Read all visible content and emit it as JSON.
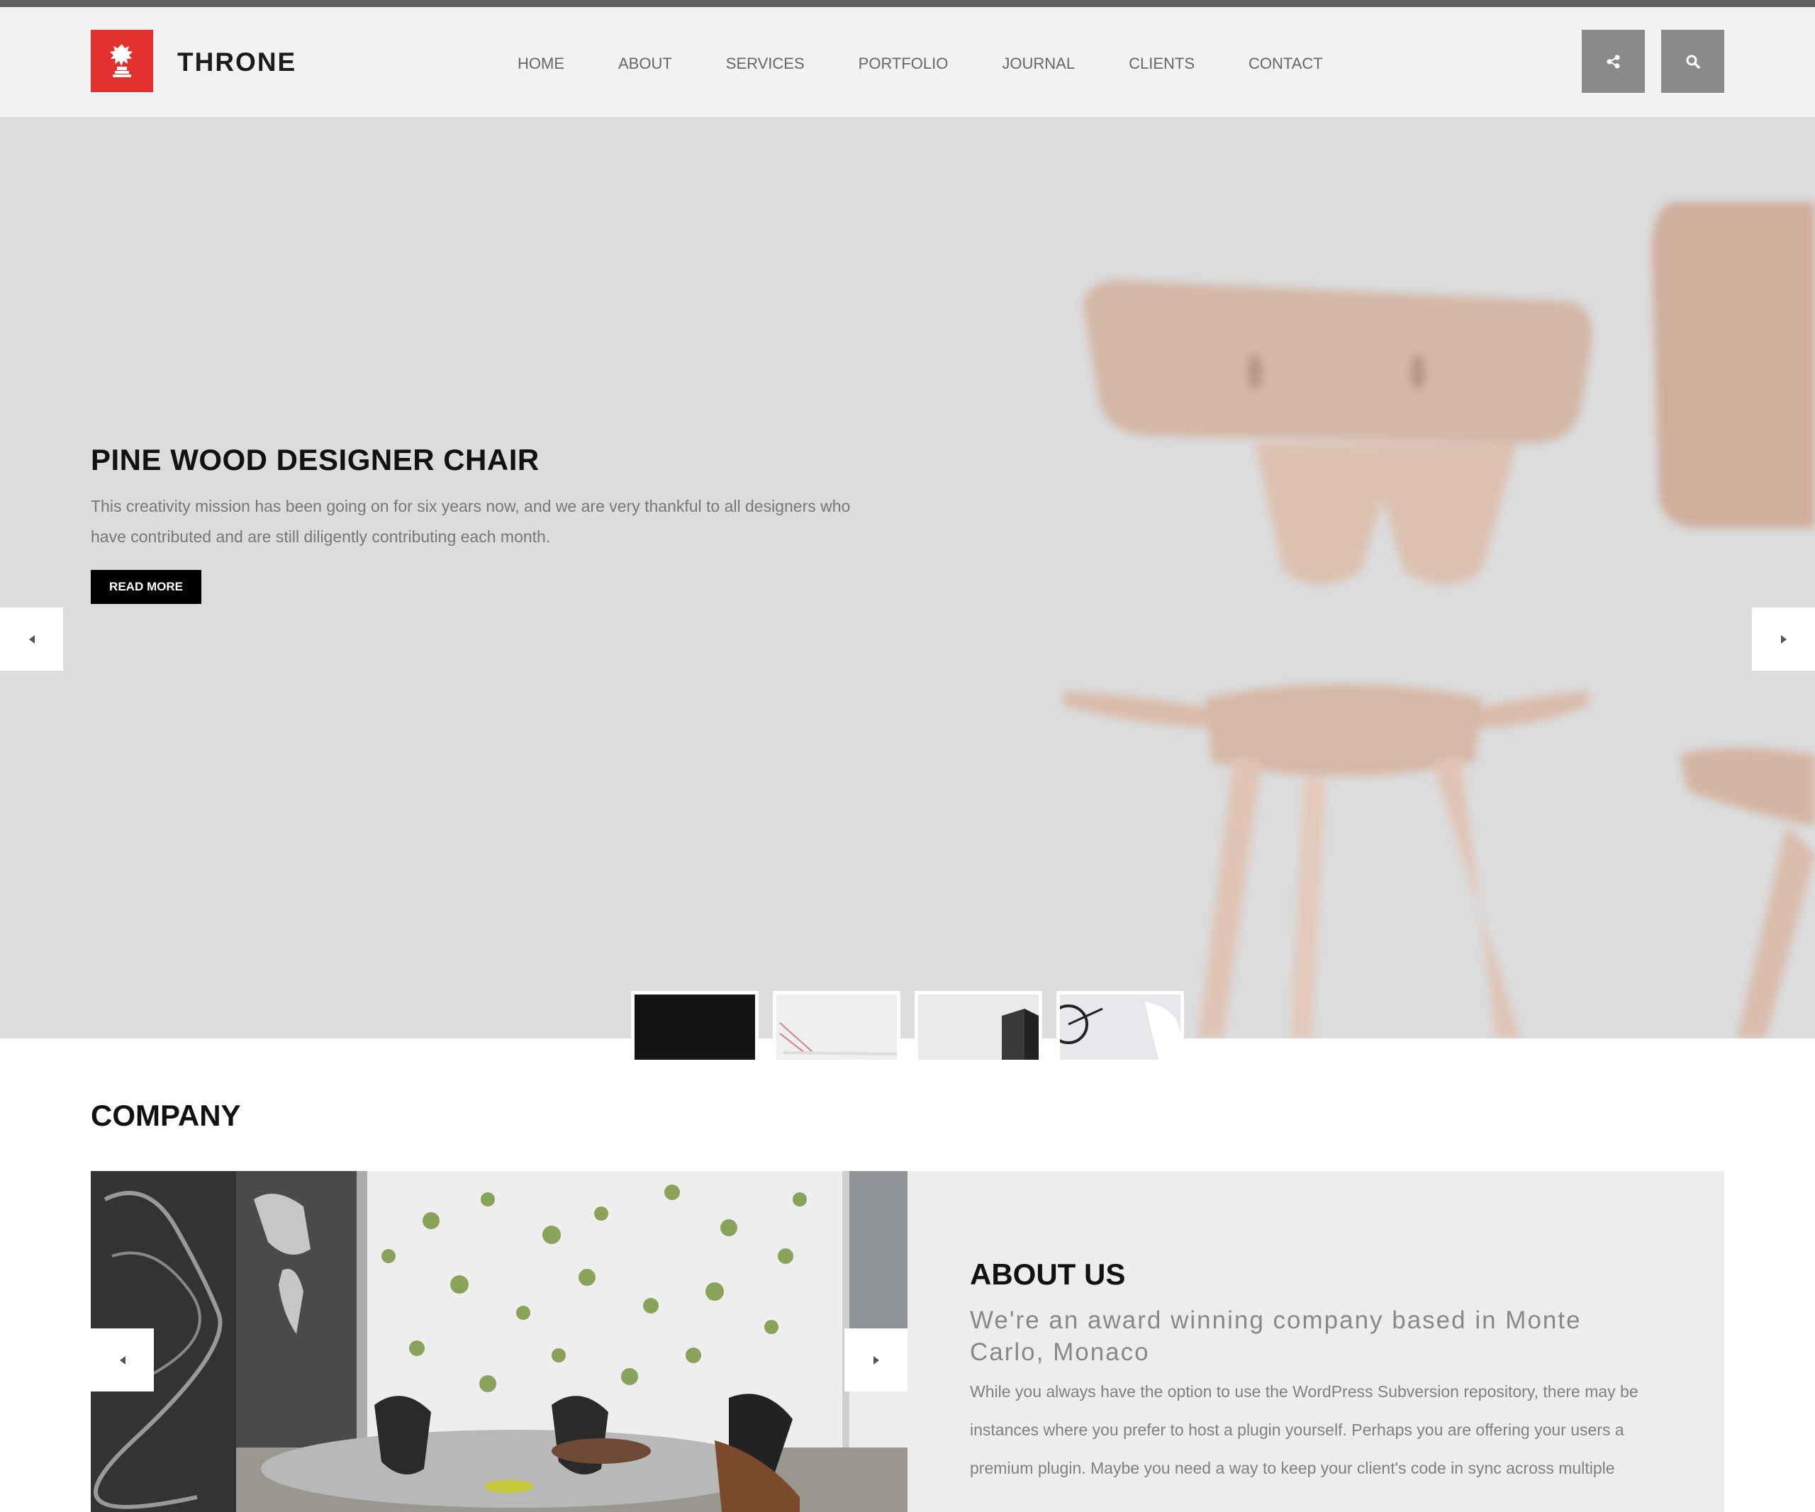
{
  "header": {
    "brand": "THRONE",
    "nav": [
      "HOME",
      "ABOUT",
      "SERVICES",
      "PORTFOLIO",
      "JOURNAL",
      "CLIENTS",
      "CONTACT"
    ],
    "share_icon": "share-icon",
    "search_icon": "search-icon"
  },
  "hero": {
    "title": "PINE WOOD DESIGNER CHAIR",
    "text": "This creativity mission has been going on for six years now, and we are very thankful to all designers who have contributed and are still diligently contributing each month.",
    "button": "READ MORE"
  },
  "company": {
    "title": "COMPANY",
    "about_title": "ABOUT US",
    "about_subtitle": "We're an award winning company based in Monte Carlo, Monaco",
    "about_text": "While you always have the option to use the WordPress Subversion repository, there may be instances where you prefer to host a plugin yourself. Perhaps you are offering your users a premium plugin. Maybe you need a way to keep your client's code in sync across multiple"
  },
  "colors": {
    "brand_red": "#e2312f",
    "header_bg": "#f2f2f2",
    "hero_bg": "#dcdcdc",
    "button_bg": "#000000",
    "icon_button_bg": "#8a8a8a"
  }
}
